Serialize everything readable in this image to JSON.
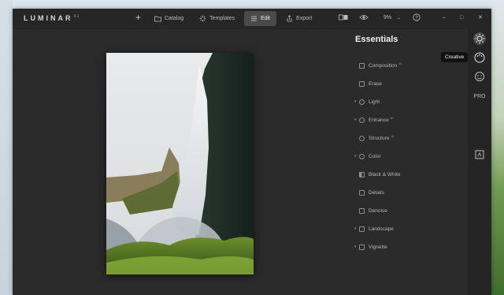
{
  "app": {
    "name": "LUMINAR",
    "version": "4.1"
  },
  "nav": {
    "add_label": "+",
    "catalog_label": "Catalog",
    "templates_label": "Templates",
    "edit_label": "Edit",
    "export_label": "Export",
    "active": "Edit"
  },
  "top_right": {
    "zoom": "9%",
    "zoom_caret": "⌄",
    "help": "?"
  },
  "window_controls": {
    "minimize": "–",
    "maximize": "□",
    "close": "✕"
  },
  "panel": {
    "title": "Essentials",
    "tools": [
      {
        "label": "Composition",
        "ai": "AI",
        "icon": "crop-icon",
        "expandable": false
      },
      {
        "label": "Erase",
        "ai": "",
        "icon": "eraser-icon",
        "expandable": false
      },
      {
        "label": "Light",
        "ai": "",
        "icon": "sun-icon",
        "expandable": true
      },
      {
        "label": "Enhance",
        "ai": "AI",
        "icon": "sparkle-icon",
        "expandable": true
      },
      {
        "label": "Structure",
        "ai": "AI",
        "icon": "structure-icon",
        "expandable": false
      },
      {
        "label": "Color",
        "ai": "",
        "icon": "palette-icon",
        "expandable": true
      },
      {
        "label": "Black & White",
        "ai": "",
        "icon": "bw-icon",
        "expandable": false
      },
      {
        "label": "Details",
        "ai": "",
        "icon": "details-icon",
        "expandable": false
      },
      {
        "label": "Denoise",
        "ai": "",
        "icon": "denoise-icon",
        "expandable": false
      },
      {
        "label": "Landscape",
        "ai": "",
        "icon": "landscape-icon",
        "expandable": true
      },
      {
        "label": "Vignette",
        "ai": "",
        "icon": "vignette-icon",
        "expandable": true
      }
    ]
  },
  "sidebar": {
    "tooltip": "Creative",
    "pro_label": "PRO",
    "items": [
      "essentials-sun-icon",
      "creative-palette-icon",
      "portrait-face-icon",
      "pro-icon",
      "layers-icon"
    ]
  },
  "colors": {
    "window_bg": "#2b2b2b",
    "titlebar_bg": "#262626",
    "active_tab_bg": "#4a4a4a"
  }
}
